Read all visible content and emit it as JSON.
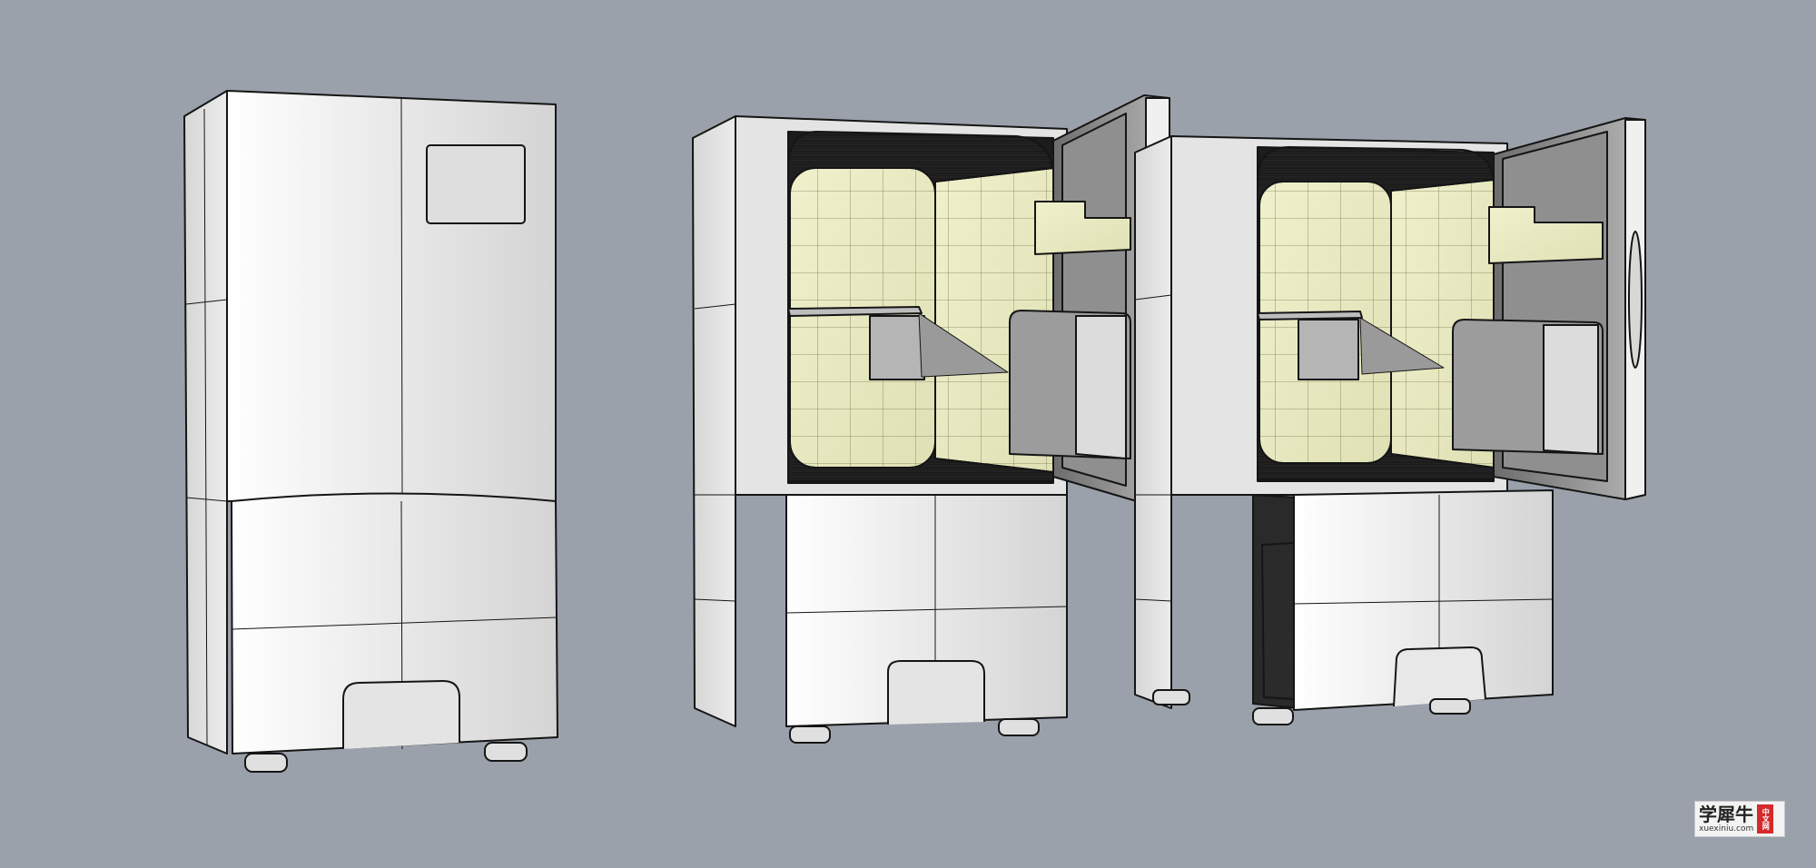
{
  "scene": {
    "background": "#9aa1ab",
    "body_color": "#e6e6e6",
    "interior_color": "#e8e9c2",
    "line_color": "#151515",
    "objects": [
      "refrigerator-closed",
      "refrigerator-upper-door-open",
      "refrigerator-both-doors-open"
    ]
  },
  "watermark": {
    "name": "学犀牛",
    "url": "xuexiniu.com",
    "seal": "中文网"
  }
}
